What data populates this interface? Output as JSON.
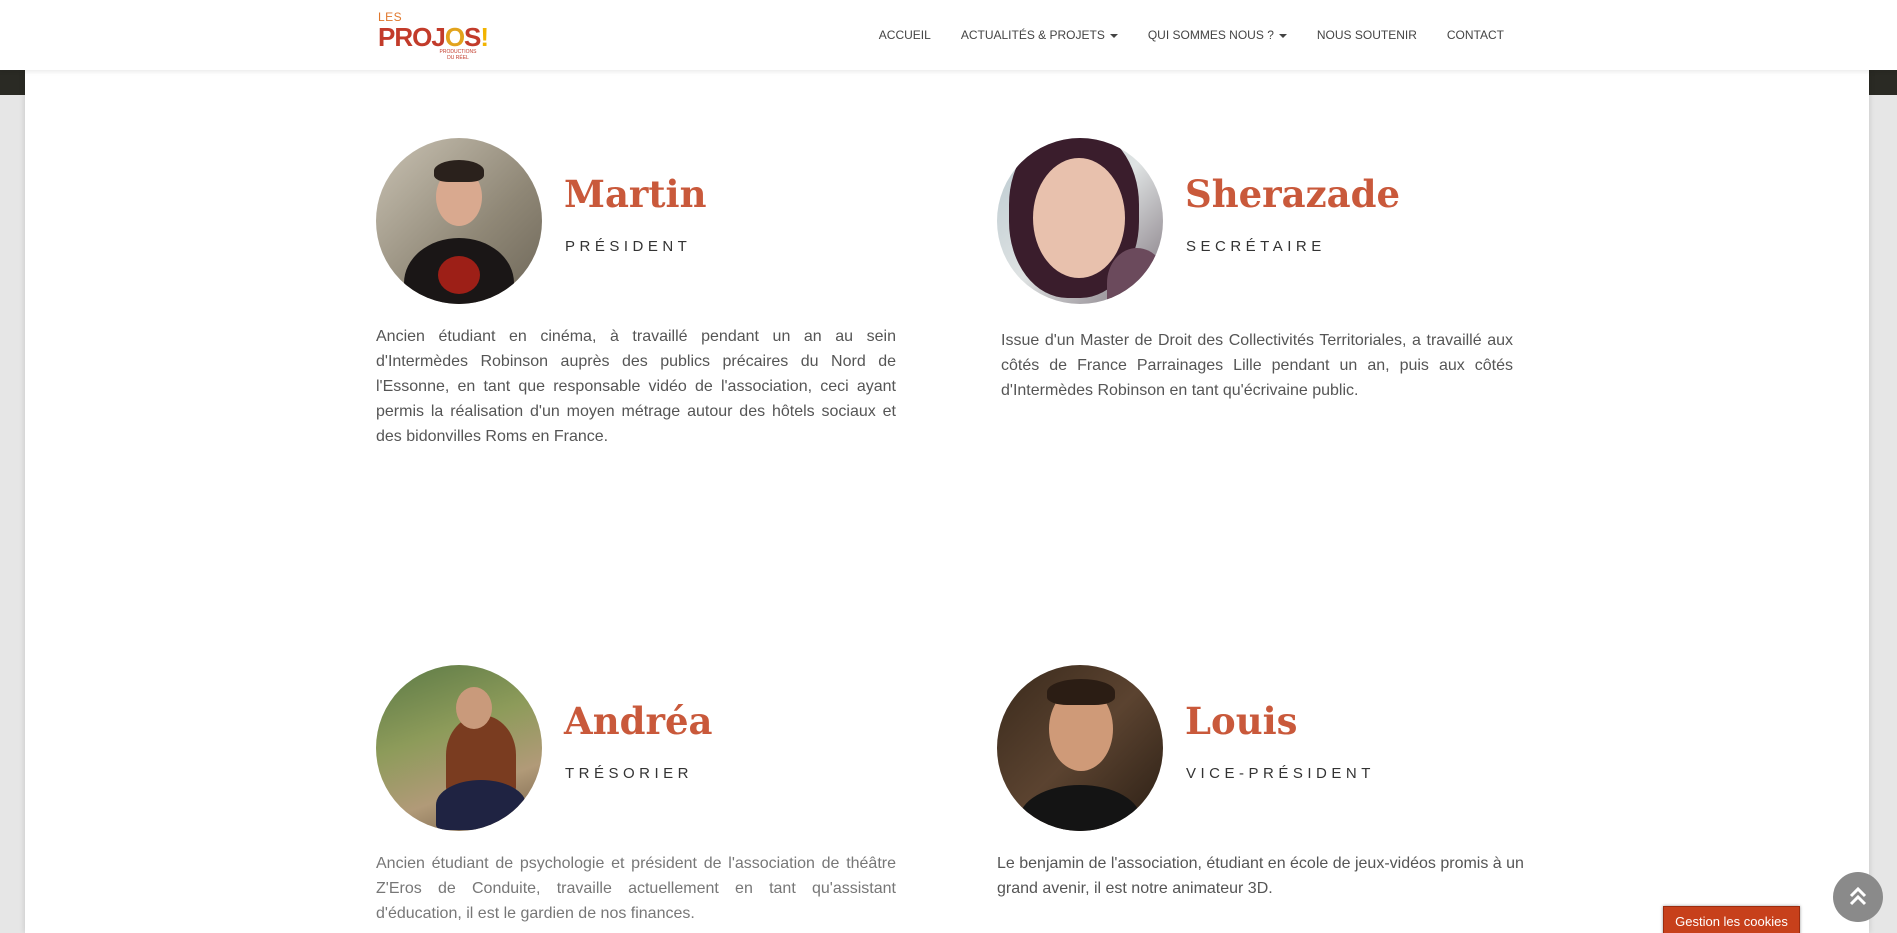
{
  "brand": {
    "logo_line1": "LES",
    "logo_line2_a": "PROJ",
    "logo_line2_o": "O",
    "logo_line2_b": "S",
    "logo_line2_bang": "!",
    "logo_tagline": "PRODUCTIONS DU RÉEL"
  },
  "nav": {
    "items": [
      {
        "label": "ACCUEIL"
      },
      {
        "label": "ACTUALITÉS & PROJETS"
      },
      {
        "label": "QUI SOMMES NOUS ?"
      },
      {
        "label": "NOUS SOUTENIR"
      },
      {
        "label": "CONTACT"
      }
    ]
  },
  "team": [
    {
      "name": "Martin",
      "role": "PRÉSIDENT",
      "desc": "Ancien étudiant en cinéma, à travaillé pendant un an au sein d'Intermèdes Robinson auprès des publics précaires du Nord de l'Essonne, en tant que responsable vidéo de l'association, ceci ayant permis la réalisation d'un moyen métrage autour des hôtels sociaux et des bidonvilles Roms en France."
    },
    {
      "name": "Sherazade",
      "role": "SECRÉTAIRE",
      "desc": "Issue d'un Master de Droit des Collectivités Territoriales, a travaillé aux côtés de France Parrainages Lille pendant un an, puis aux côtés d'Intermèdes Robinson en tant qu'écrivaine public."
    },
    {
      "name": "Andréa",
      "role": "TRÉSORIER",
      "desc": "Ancien étudiant de psychologie et président de l'association de théâtre Z'Eros de Conduite, travaille actuellement en tant qu'assistant d'éducation, il est le gardien de nos finances."
    },
    {
      "name": "Louis",
      "role": "VICE-PRÉSIDENT",
      "desc": "Le benjamin de l'association, étudiant en école de jeux-vidéos promis à un grand avenir, il est notre animateur 3D."
    }
  ],
  "cookie": {
    "label": "Gestion les cookies"
  },
  "colors": {
    "accent": "#c9593b",
    "cookie_bg": "#c7401b"
  }
}
